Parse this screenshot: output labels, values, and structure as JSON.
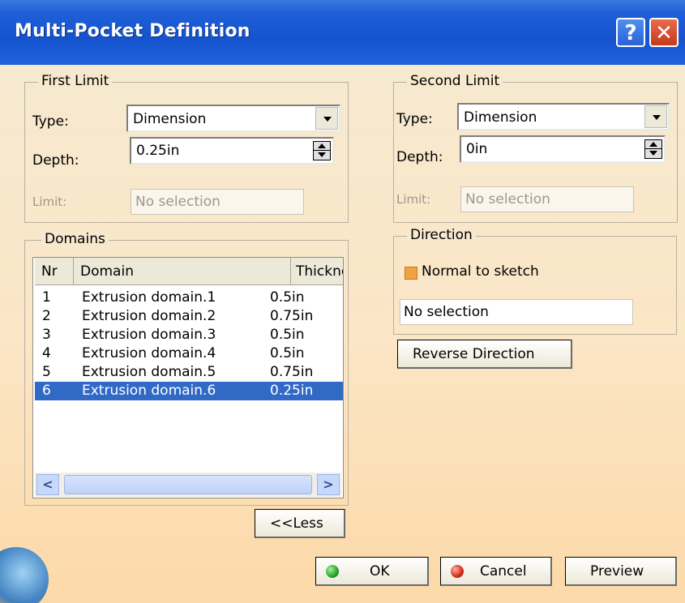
{
  "window": {
    "title": "Multi-Pocket Definition",
    "help_glyph": "?",
    "close_glyph": "✕"
  },
  "first_limit": {
    "legend": "First Limit",
    "type_label": "Type:",
    "type_value": "Dimension",
    "depth_label": "Depth:",
    "depth_value": "0.25in",
    "limit_label": "Limit:",
    "limit_value": "No selection"
  },
  "second_limit": {
    "legend": "Second Limit",
    "type_label": "Type:",
    "type_value": "Dimension",
    "depth_label": "Depth:",
    "depth_value": "0in",
    "limit_label": "Limit:",
    "limit_value": "No selection"
  },
  "domains": {
    "legend": "Domains",
    "columns": [
      "Nr",
      "Domain",
      "Thicknes:"
    ],
    "rows": [
      {
        "nr": "1",
        "domain": "Extrusion domain.1",
        "thickness": "0.5in"
      },
      {
        "nr": "2",
        "domain": "Extrusion domain.2",
        "thickness": "0.75in"
      },
      {
        "nr": "3",
        "domain": "Extrusion domain.3",
        "thickness": "0.5in"
      },
      {
        "nr": "4",
        "domain": "Extrusion domain.4",
        "thickness": "0.5in"
      },
      {
        "nr": "5",
        "domain": "Extrusion domain.5",
        "thickness": "0.75in"
      },
      {
        "nr": "6",
        "domain": "Extrusion domain.6",
        "thickness": "0.25in"
      }
    ],
    "selected_index": 5
  },
  "direction": {
    "legend": "Direction",
    "normal_label": "Normal to sketch",
    "selection_value": "No selection",
    "reverse_label": "Reverse Direction"
  },
  "buttons": {
    "less": "<<Less",
    "ok": "OK",
    "cancel": "Cancel",
    "preview": "Preview"
  },
  "colors": {
    "selection": "#3169c6",
    "ok_dot": "#2aa12a",
    "cancel_dot": "#d42a1a"
  }
}
